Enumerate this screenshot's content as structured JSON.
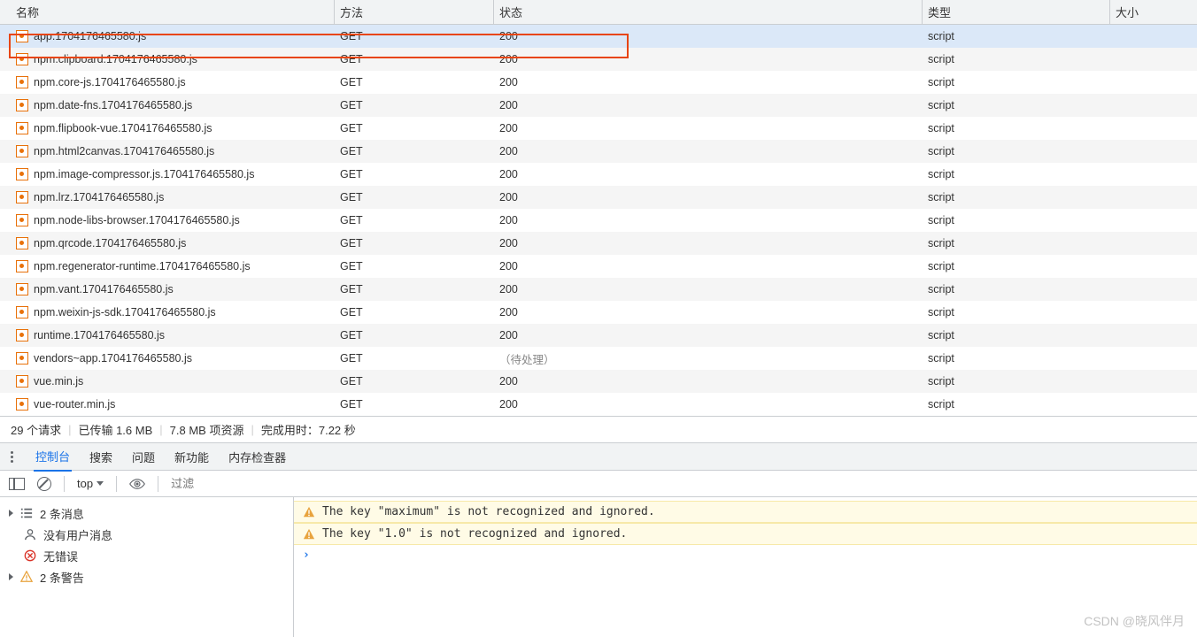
{
  "columns": {
    "name": "名称",
    "method": "方法",
    "status": "状态",
    "type": "类型",
    "size": "大小"
  },
  "rows": [
    {
      "name": "app.1704176465580.js",
      "method": "GET",
      "status": "200",
      "type": "script",
      "selected": true
    },
    {
      "name": "npm.clipboard.1704176465580.js",
      "method": "GET",
      "status": "200",
      "type": "script"
    },
    {
      "name": "npm.core-js.1704176465580.js",
      "method": "GET",
      "status": "200",
      "type": "script"
    },
    {
      "name": "npm.date-fns.1704176465580.js",
      "method": "GET",
      "status": "200",
      "type": "script"
    },
    {
      "name": "npm.flipbook-vue.1704176465580.js",
      "method": "GET",
      "status": "200",
      "type": "script"
    },
    {
      "name": "npm.html2canvas.1704176465580.js",
      "method": "GET",
      "status": "200",
      "type": "script"
    },
    {
      "name": "npm.image-compressor.js.1704176465580.js",
      "method": "GET",
      "status": "200",
      "type": "script"
    },
    {
      "name": "npm.lrz.1704176465580.js",
      "method": "GET",
      "status": "200",
      "type": "script"
    },
    {
      "name": "npm.node-libs-browser.1704176465580.js",
      "method": "GET",
      "status": "200",
      "type": "script"
    },
    {
      "name": "npm.qrcode.1704176465580.js",
      "method": "GET",
      "status": "200",
      "type": "script"
    },
    {
      "name": "npm.regenerator-runtime.1704176465580.js",
      "method": "GET",
      "status": "200",
      "type": "script"
    },
    {
      "name": "npm.vant.1704176465580.js",
      "method": "GET",
      "status": "200",
      "type": "script"
    },
    {
      "name": "npm.weixin-js-sdk.1704176465580.js",
      "method": "GET",
      "status": "200",
      "type": "script"
    },
    {
      "name": "runtime.1704176465580.js",
      "method": "GET",
      "status": "200",
      "type": "script"
    },
    {
      "name": "vendors~app.1704176465580.js",
      "method": "GET",
      "status": "（待处理）",
      "type": "script",
      "pending": true
    },
    {
      "name": "vue.min.js",
      "method": "GET",
      "status": "200",
      "type": "script"
    },
    {
      "name": "vue-router.min.js",
      "method": "GET",
      "status": "200",
      "type": "script"
    }
  ],
  "status_bar": {
    "requests": "29 个请求",
    "transferred": "已传输 1.6 MB",
    "resources": "7.8 MB 项资源",
    "finish_label": "完成用时：",
    "finish_value": "7.22 秒"
  },
  "tabs": {
    "console": "控制台",
    "search": "搜索",
    "issues": "问题",
    "whatsnew": "新功能",
    "memory": "内存检查器"
  },
  "toolbar": {
    "context": "top",
    "filter_placeholder": "过滤"
  },
  "sidebar": {
    "messages_label": "2 条消息",
    "user_label": "没有用户消息",
    "errors_label": "无错误",
    "warnings_label": "2 条警告"
  },
  "console_msgs": [
    "The key \"maximum\" is not recognized and ignored.",
    "The key \"1.0\" is not recognized and ignored."
  ],
  "prompt": "›",
  "watermark": "CSDN @晓风伴月"
}
